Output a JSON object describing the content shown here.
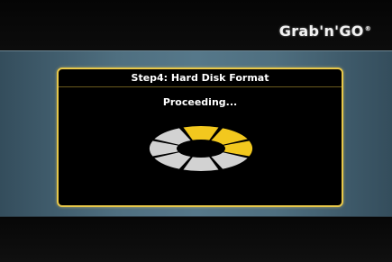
{
  "brand": {
    "logo_text": "Grab'n'GO",
    "trademark": "®"
  },
  "dialog": {
    "title": "Step4: Hard Disk Format",
    "status": "Proceeding...",
    "spinner": {
      "segments": 8,
      "active_segments": 3,
      "icon": "progress-spinner-icon",
      "active_color": "#f2c81e",
      "inactive_color": "#d2d2d2"
    }
  },
  "colors": {
    "band": "#4f6f80",
    "dialog_border": "#e8c84a",
    "background": "#000000"
  }
}
